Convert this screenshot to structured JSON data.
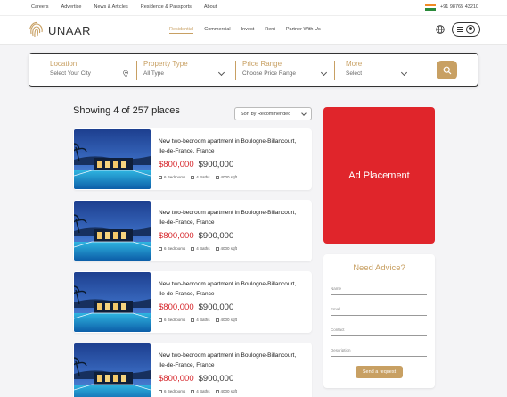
{
  "topbar": {
    "links": [
      "Careers",
      "Advertise",
      "News & Articles",
      "Residence & Passports",
      "About"
    ],
    "phone": "+91 98765 43210"
  },
  "brand": {
    "name": "UNAAR",
    "accent": "#c8a063"
  },
  "nav": {
    "items": [
      "Residential",
      "Commercial",
      "Invest",
      "Rent",
      "Partner With Us"
    ],
    "active": "Residential"
  },
  "search": {
    "location": {
      "label": "Location",
      "value": "Select Your City"
    },
    "type": {
      "label": "Property Type",
      "value": "All Type"
    },
    "price": {
      "label": "Price Range",
      "value": "Choose Price Range"
    },
    "more": {
      "label": "More",
      "value": "Select"
    }
  },
  "results": {
    "title": "Showing 4 of 257 places",
    "sort_label": "Sort by Recommended"
  },
  "listings": [
    {
      "title": "New two-bedroom apartment in Boulogne-Billancourt, Ile-de-France, France",
      "price": "$800,000",
      "old_price": "$900,000",
      "beds": "6 Bedrooms",
      "baths": "4 Baths",
      "area": "4000 sqft"
    },
    {
      "title": "New two-bedroom apartment in Boulogne-Billancourt, Ile-de-France, France",
      "price": "$800,000",
      "old_price": "$900,000",
      "beds": "6 Bedrooms",
      "baths": "4 Baths",
      "area": "4000 sqft"
    },
    {
      "title": "New two-bedroom apartment in Boulogne-Billancourt, Ile-de-France, France",
      "price": "$800,000",
      "old_price": "$900,000",
      "beds": "6 Bedrooms",
      "baths": "4 Baths",
      "area": "4000 sqft"
    },
    {
      "title": "New two-bedroom apartment in Boulogne-Billancourt, Ile-de-France, France",
      "price": "$800,000",
      "old_price": "$900,000",
      "beds": "6 Bedrooms",
      "baths": "4 Baths",
      "area": "4000 sqft"
    }
  ],
  "ad": {
    "label": "Ad Placement",
    "color": "#e0252b"
  },
  "advice": {
    "title": "Need Advice?",
    "fields": [
      "Name",
      "Email",
      "Contact",
      "Description"
    ],
    "button": "Send a request"
  },
  "colors": {
    "price": "#d6262b",
    "accent": "#c8a063"
  }
}
